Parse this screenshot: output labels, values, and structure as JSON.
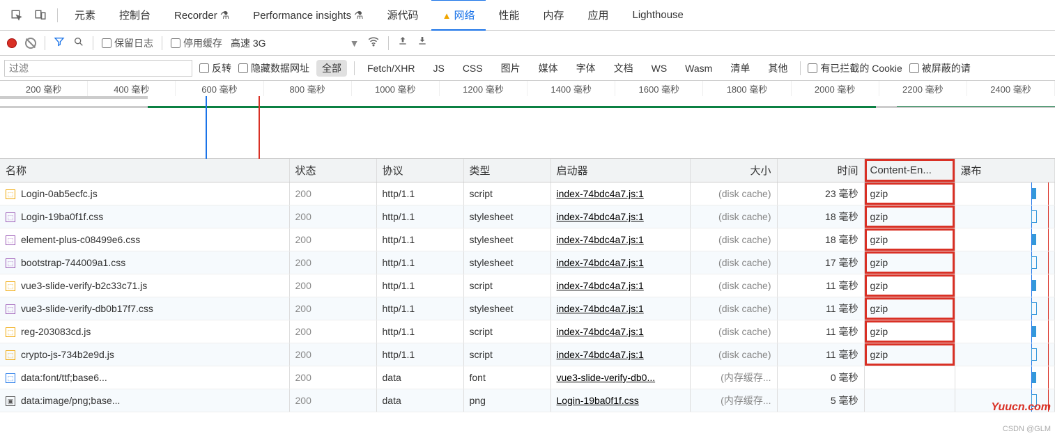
{
  "top_tabs": {
    "elements": "元素",
    "console": "控制台",
    "recorder": "Recorder",
    "perf_insights": "Performance insights",
    "sources": "源代码",
    "network": "网络",
    "performance": "性能",
    "memory": "内存",
    "application": "应用",
    "lighthouse": "Lighthouse"
  },
  "toolbar": {
    "preserve_log": "保留日志",
    "disable_cache": "停用缓存",
    "throttle": "高速 3G"
  },
  "filter": {
    "placeholder": "过滤",
    "invert": "反转",
    "hide_data": "隐藏数据网址",
    "all": "全部",
    "fetch": "Fetch/XHR",
    "js": "JS",
    "css": "CSS",
    "img": "图片",
    "media": "媒体",
    "font": "字体",
    "doc": "文档",
    "ws": "WS",
    "wasm": "Wasm",
    "manifest": "清单",
    "other": "其他",
    "blocked_cookies": "有已拦截的 Cookie",
    "blocked_req": "被屏蔽的请"
  },
  "timeline_ticks": [
    "200 毫秒",
    "400 毫秒",
    "600 毫秒",
    "800 毫秒",
    "1000 毫秒",
    "1200 毫秒",
    "1400 毫秒",
    "1600 毫秒",
    "1800 毫秒",
    "2000 毫秒",
    "2200 毫秒",
    "2400 毫秒"
  ],
  "cols": {
    "name": "名称",
    "status": "状态",
    "protocol": "协议",
    "type": "类型",
    "initiator": "启动器",
    "size": "大小",
    "time": "时间",
    "encoding": "Content-En...",
    "waterfall": "瀑布"
  },
  "rows": [
    {
      "icon": "js",
      "name": "Login-0ab5ecfc.js",
      "status": "200",
      "protocol": "http/1.1",
      "type": "script",
      "initiator": "index-74bdc4a7.js:1",
      "size": "(disk cache)",
      "time": "23 毫秒",
      "enc": "gzip"
    },
    {
      "icon": "css",
      "name": "Login-19ba0f1f.css",
      "status": "200",
      "protocol": "http/1.1",
      "type": "stylesheet",
      "initiator": "index-74bdc4a7.js:1",
      "size": "(disk cache)",
      "time": "18 毫秒",
      "enc": "gzip"
    },
    {
      "icon": "css",
      "name": "element-plus-c08499e6.css",
      "status": "200",
      "protocol": "http/1.1",
      "type": "stylesheet",
      "initiator": "index-74bdc4a7.js:1",
      "size": "(disk cache)",
      "time": "18 毫秒",
      "enc": "gzip"
    },
    {
      "icon": "css",
      "name": "bootstrap-744009a1.css",
      "status": "200",
      "protocol": "http/1.1",
      "type": "stylesheet",
      "initiator": "index-74bdc4a7.js:1",
      "size": "(disk cache)",
      "time": "17 毫秒",
      "enc": "gzip"
    },
    {
      "icon": "js",
      "name": "vue3-slide-verify-b2c33c71.js",
      "status": "200",
      "protocol": "http/1.1",
      "type": "script",
      "initiator": "index-74bdc4a7.js:1",
      "size": "(disk cache)",
      "time": "11 毫秒",
      "enc": "gzip"
    },
    {
      "icon": "css",
      "name": "vue3-slide-verify-db0b17f7.css",
      "status": "200",
      "protocol": "http/1.1",
      "type": "stylesheet",
      "initiator": "index-74bdc4a7.js:1",
      "size": "(disk cache)",
      "time": "11 毫秒",
      "enc": "gzip"
    },
    {
      "icon": "js",
      "name": "reg-203083cd.js",
      "status": "200",
      "protocol": "http/1.1",
      "type": "script",
      "initiator": "index-74bdc4a7.js:1",
      "size": "(disk cache)",
      "time": "11 毫秒",
      "enc": "gzip"
    },
    {
      "icon": "js",
      "name": "crypto-js-734b2e9d.js",
      "status": "200",
      "protocol": "http/1.1",
      "type": "script",
      "initiator": "index-74bdc4a7.js:1",
      "size": "(disk cache)",
      "time": "11 毫秒",
      "enc": "gzip"
    },
    {
      "icon": "font",
      "name": "data:font/ttf;base6...",
      "status": "200",
      "protocol": "data",
      "type": "font",
      "initiator": "vue3-slide-verify-db0...",
      "size": "(内存缓存...",
      "time": "0 毫秒",
      "enc": ""
    },
    {
      "icon": "img",
      "name": "data:image/png;base...",
      "status": "200",
      "protocol": "data",
      "type": "png",
      "initiator": "Login-19ba0f1f.css",
      "size": "(内存缓存...",
      "time": "5 毫秒",
      "enc": ""
    }
  ],
  "watermark1": "Yuucn.com",
  "watermark2": "CSDN @GLM"
}
